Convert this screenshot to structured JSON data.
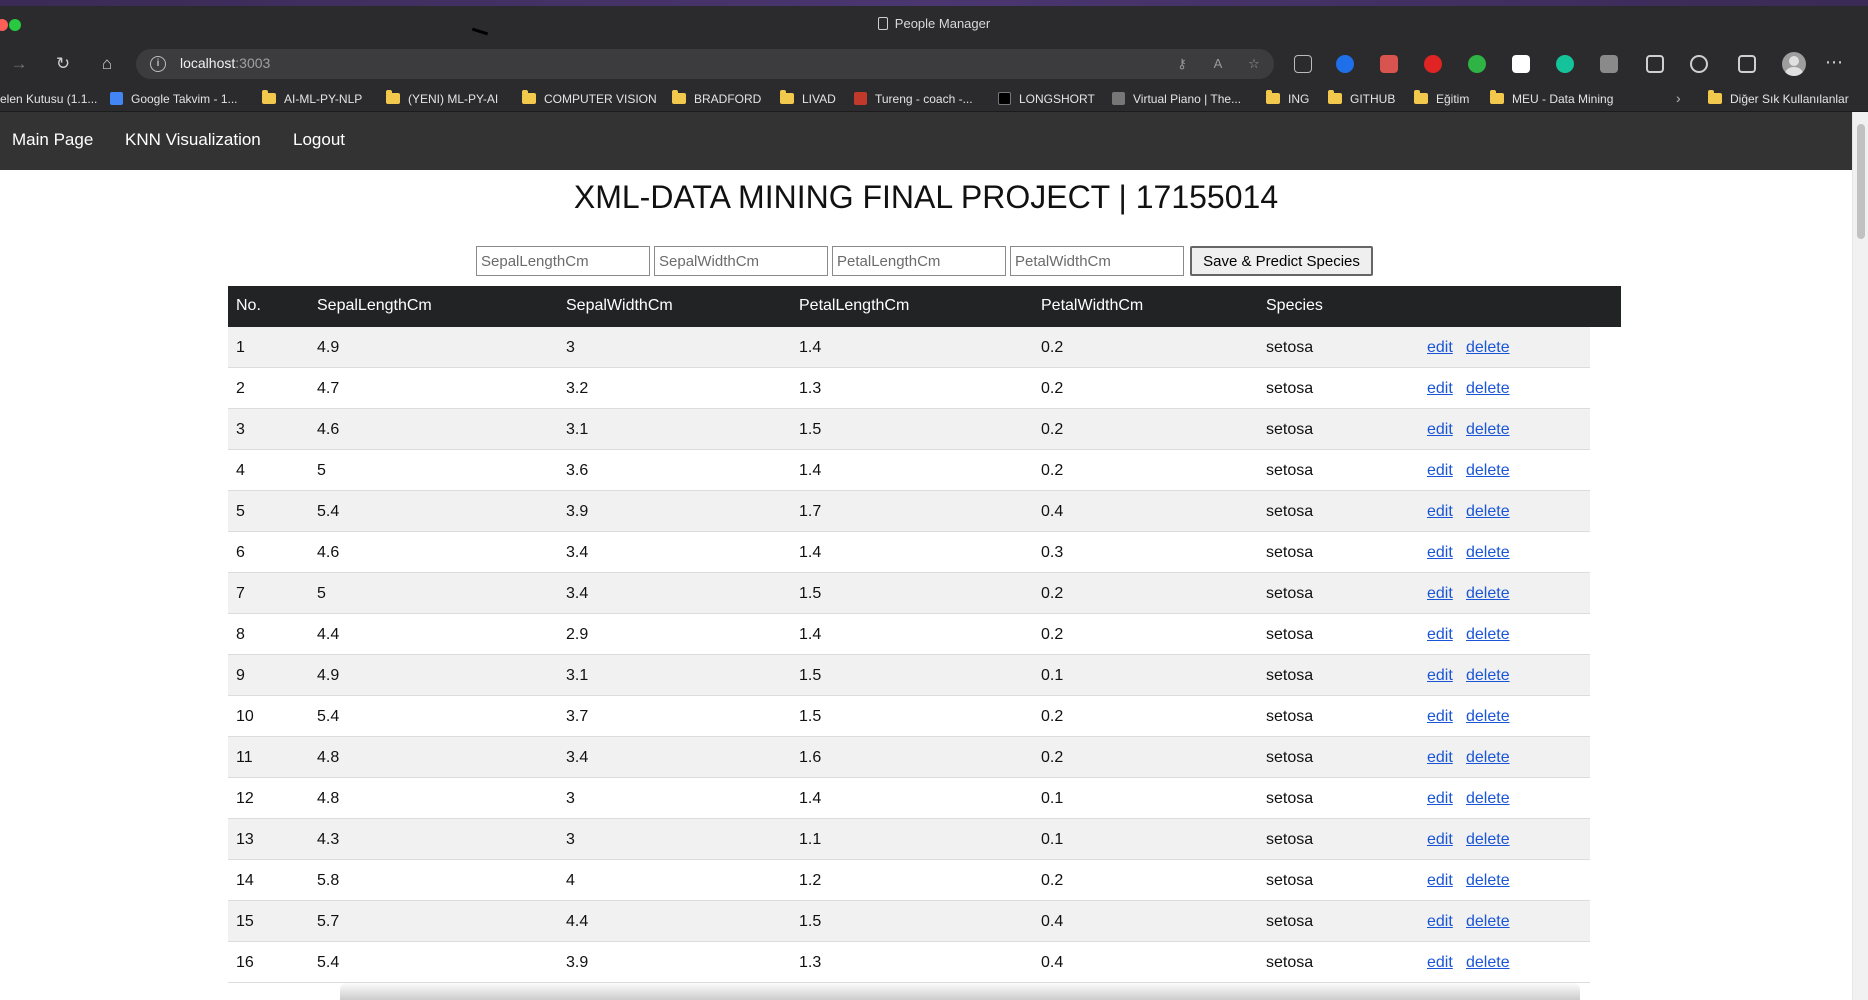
{
  "browser": {
    "window_title": "People Manager",
    "url_host": "localhost",
    "url_port": ":3003",
    "icons": [
      "back-icon",
      "forward-icon",
      "reload-icon",
      "home-icon",
      "info-icon",
      "key-icon",
      "read-aloud-icon",
      "favorite-icon"
    ],
    "bookmarks": [
      {
        "label": "elen Kutusu (1.1...",
        "kind": "site",
        "color": "#3a6fd8"
      },
      {
        "label": "Google Takvim - 1...",
        "kind": "site",
        "color": "#4285f4"
      },
      {
        "label": "AI-ML-PY-NLP",
        "kind": "folder"
      },
      {
        "label": "(YENI) ML-PY-AI",
        "kind": "folder"
      },
      {
        "label": "COMPUTER VISION",
        "kind": "folder"
      },
      {
        "label": "BRADFORD",
        "kind": "folder"
      },
      {
        "label": "LIVAD",
        "kind": "folder"
      },
      {
        "label": "Tureng - coach -...",
        "kind": "site",
        "color": "#c0392b"
      },
      {
        "label": "LONGSHORT",
        "kind": "site",
        "color": "#000000"
      },
      {
        "label": "Virtual Piano | The...",
        "kind": "site",
        "color": "#777777"
      },
      {
        "label": "ING",
        "kind": "folder"
      },
      {
        "label": "GITHUB",
        "kind": "folder"
      },
      {
        "label": "Eğitim",
        "kind": "folder"
      },
      {
        "label": "MEU - Data Mining",
        "kind": "folder"
      },
      {
        "label": "Diğer Sık Kullanılanlar",
        "kind": "folder"
      }
    ]
  },
  "nav": {
    "main_page": "Main Page",
    "knn": "KNN Visualization",
    "logout": "Logout"
  },
  "page_title": "XML-DATA MINING FINAL PROJECT | 17155014",
  "form": {
    "sepal_length_placeholder": "SepalLengthCm",
    "sepal_width_placeholder": "SepalWidthCm",
    "petal_length_placeholder": "PetalLengthCm",
    "petal_width_placeholder": "PetalWidthCm",
    "submit_label": "Save & Predict Species"
  },
  "table": {
    "headers": [
      "No.",
      "SepalLengthCm",
      "SepalWidthCm",
      "PetalLengthCm",
      "PetalWidthCm",
      "Species"
    ],
    "edit_label": "edit",
    "delete_label": "delete",
    "rows": [
      [
        "1",
        "4.9",
        "3",
        "1.4",
        "0.2",
        "setosa"
      ],
      [
        "2",
        "4.7",
        "3.2",
        "1.3",
        "0.2",
        "setosa"
      ],
      [
        "3",
        "4.6",
        "3.1",
        "1.5",
        "0.2",
        "setosa"
      ],
      [
        "4",
        "5",
        "3.6",
        "1.4",
        "0.2",
        "setosa"
      ],
      [
        "5",
        "5.4",
        "3.9",
        "1.7",
        "0.4",
        "setosa"
      ],
      [
        "6",
        "4.6",
        "3.4",
        "1.4",
        "0.3",
        "setosa"
      ],
      [
        "7",
        "5",
        "3.4",
        "1.5",
        "0.2",
        "setosa"
      ],
      [
        "8",
        "4.4",
        "2.9",
        "1.4",
        "0.2",
        "setosa"
      ],
      [
        "9",
        "4.9",
        "3.1",
        "1.5",
        "0.1",
        "setosa"
      ],
      [
        "10",
        "5.4",
        "3.7",
        "1.5",
        "0.2",
        "setosa"
      ],
      [
        "11",
        "4.8",
        "3.4",
        "1.6",
        "0.2",
        "setosa"
      ],
      [
        "12",
        "4.8",
        "3",
        "1.4",
        "0.1",
        "setosa"
      ],
      [
        "13",
        "4.3",
        "3",
        "1.1",
        "0.1",
        "setosa"
      ],
      [
        "14",
        "5.8",
        "4",
        "1.2",
        "0.2",
        "setosa"
      ],
      [
        "15",
        "5.7",
        "4.4",
        "1.5",
        "0.4",
        "setosa"
      ],
      [
        "16",
        "5.4",
        "3.9",
        "1.3",
        "0.4",
        "setosa"
      ]
    ]
  }
}
